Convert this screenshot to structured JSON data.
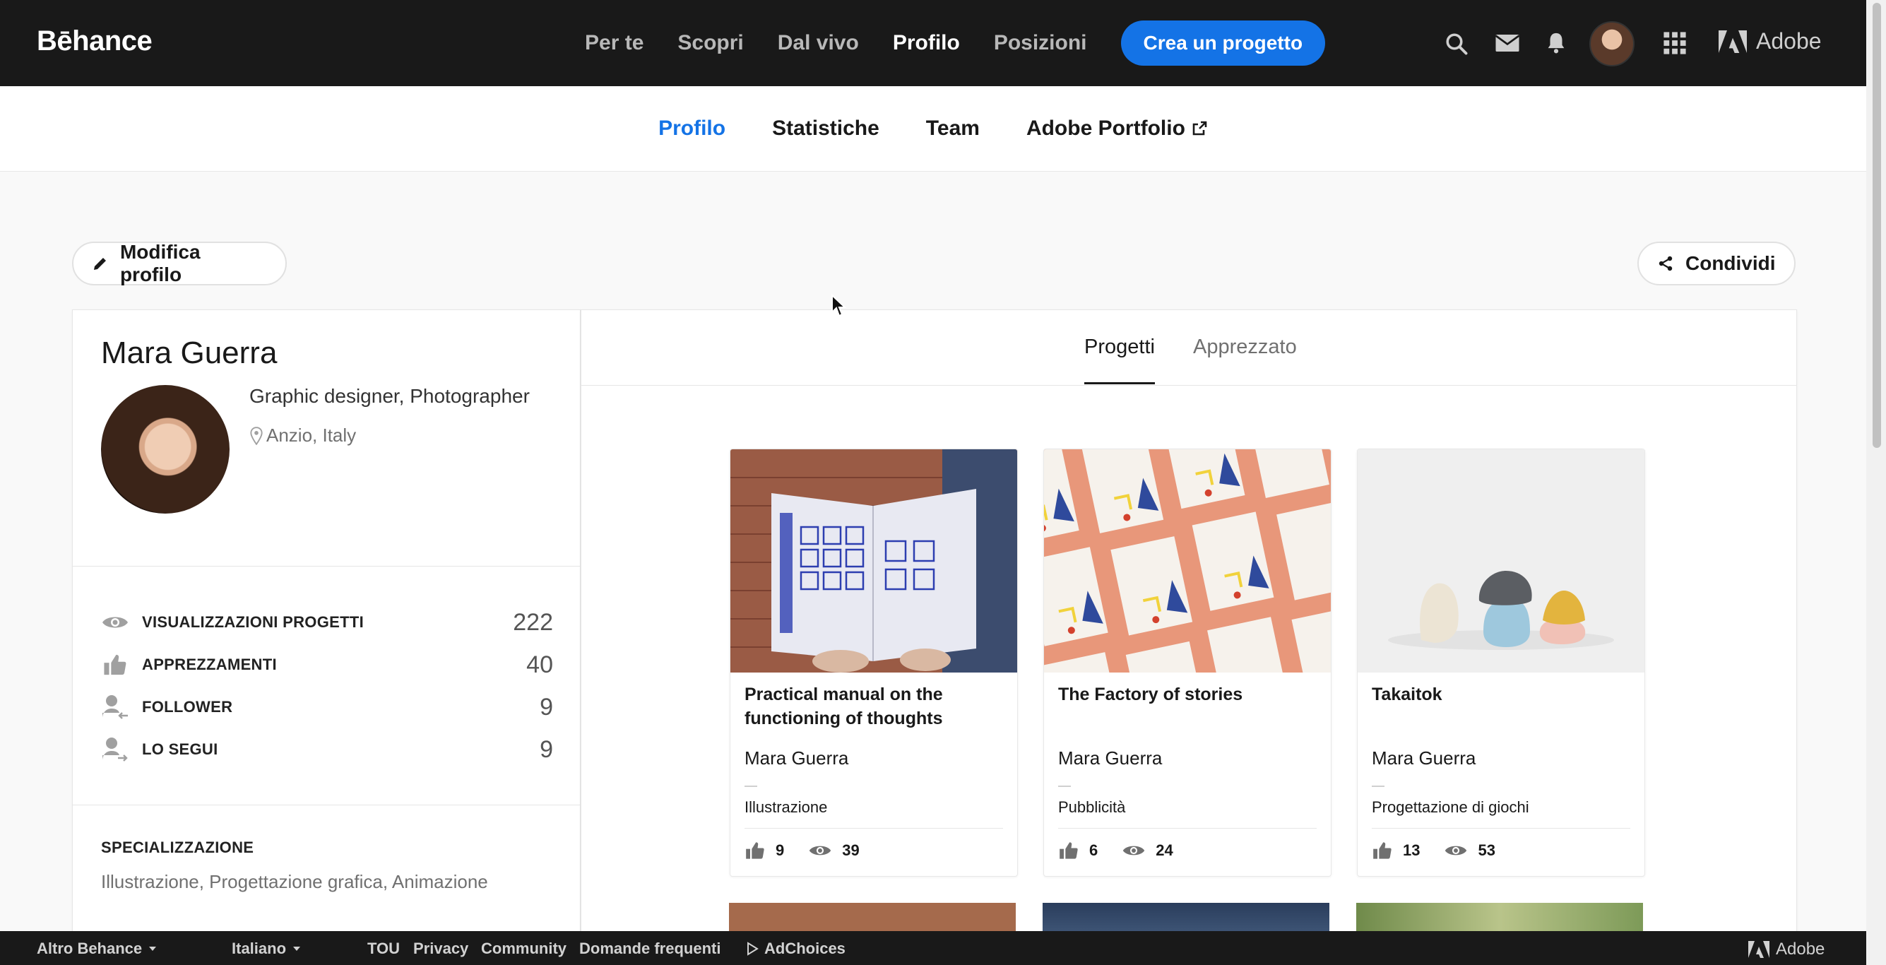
{
  "brand": {
    "logo": "Bēhance"
  },
  "topnav": {
    "items": [
      {
        "label": "Per te",
        "active": false
      },
      {
        "label": "Scopri",
        "active": false
      },
      {
        "label": "Dal vivo",
        "active": false
      },
      {
        "label": "Profilo",
        "active": true
      },
      {
        "label": "Posizioni",
        "active": false
      }
    ],
    "cta": "Crea un progetto",
    "adobe": "Adobe"
  },
  "subnav": {
    "items": [
      {
        "label": "Profilo",
        "active": true
      },
      {
        "label": "Statistiche",
        "active": false
      },
      {
        "label": "Team",
        "active": false
      },
      {
        "label": "Adobe Portfolio",
        "active": false
      }
    ]
  },
  "actions": {
    "edit_profile": "Modifica profilo",
    "share": "Condividi"
  },
  "profile": {
    "name": "Mara Guerra",
    "role": "Graphic designer, Photographer",
    "location": "Anzio, Italy",
    "stats": [
      {
        "label": "VISUALIZZAZIONI PROGETTI",
        "value": "222",
        "icon": "eye-icon"
      },
      {
        "label": "APPREZZAMENTI",
        "value": "40",
        "icon": "thumbs-up-icon"
      },
      {
        "label": "FOLLOWER",
        "value": "9",
        "icon": "follower-icon"
      },
      {
        "label": "LO SEGUI",
        "value": "9",
        "icon": "following-icon"
      }
    ],
    "specialization_title": "SPECIALIZZAZIONE",
    "specialization": "Illustrazione, Progettazione grafica, Animazione"
  },
  "tabs": [
    {
      "label": "Progetti",
      "active": true
    },
    {
      "label": "Apprezzato",
      "active": false
    }
  ],
  "projects": [
    {
      "title": "Practical manual on the functioning of thoughts",
      "owner": "Mara Guerra",
      "field": "Illustrazione",
      "likes": "9",
      "views": "39"
    },
    {
      "title": "The Factory of stories",
      "owner": "Mara Guerra",
      "field": "Pubblicità",
      "likes": "6",
      "views": "24"
    },
    {
      "title": "Takaitok",
      "owner": "Mara Guerra",
      "field": "Progettazione di giochi",
      "likes": "13",
      "views": "53"
    }
  ],
  "footer": {
    "more_behance": "Altro Behance",
    "language": "Italiano",
    "links": [
      "TOU",
      "Privacy",
      "Community",
      "Domande frequenti"
    ],
    "adchoices": "AdChoices",
    "adobe": "Adobe"
  },
  "colors": {
    "accent": "#1473e6",
    "topbar": "#191919"
  }
}
